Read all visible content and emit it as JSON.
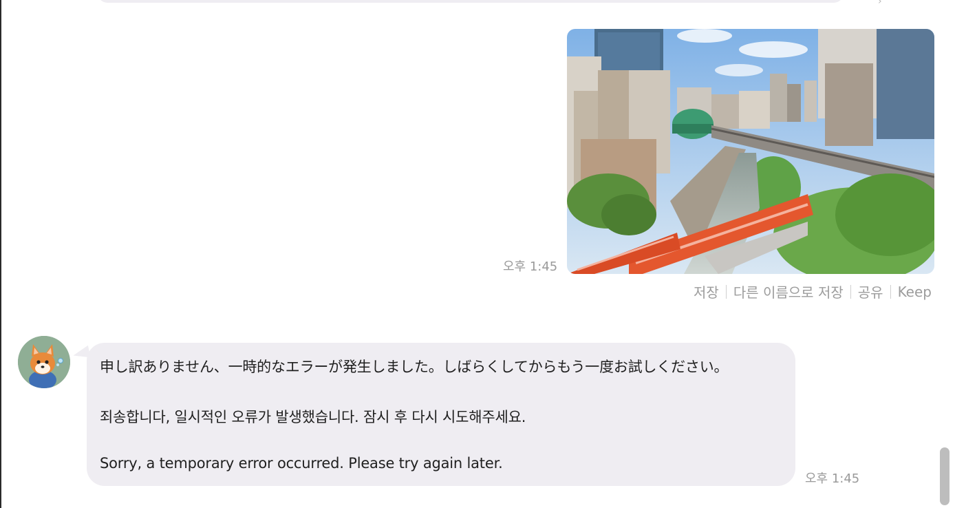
{
  "image_message": {
    "timestamp": "오후 1:45",
    "photo_icon": "tokyo-railway-photo"
  },
  "image_actions": {
    "save_label": "저장",
    "save_as_label": "다른 이름으로 저장",
    "share_label": "공유",
    "keep_label": "Keep"
  },
  "bot_message": {
    "avatar_icon": "shiba-dog-avatar-icon",
    "japanese_text": "申し訳ありません、一時的なエラーが発生しました。しばらくしてからもう一度お試しください。",
    "korean_text": "죄송합니다, 일시적인 오류가 발생했습니다. 잠시 후 다시 시도해주세요.",
    "english_text": "Sorry, a temporary error occurred. Please try again later.",
    "timestamp": "오후 1:45"
  },
  "colors": {
    "bubble_background": "#efedf2",
    "timestamp_text": "#9a9a9a",
    "message_text": "#1f1f1f",
    "train_orange": "#e4572e"
  }
}
